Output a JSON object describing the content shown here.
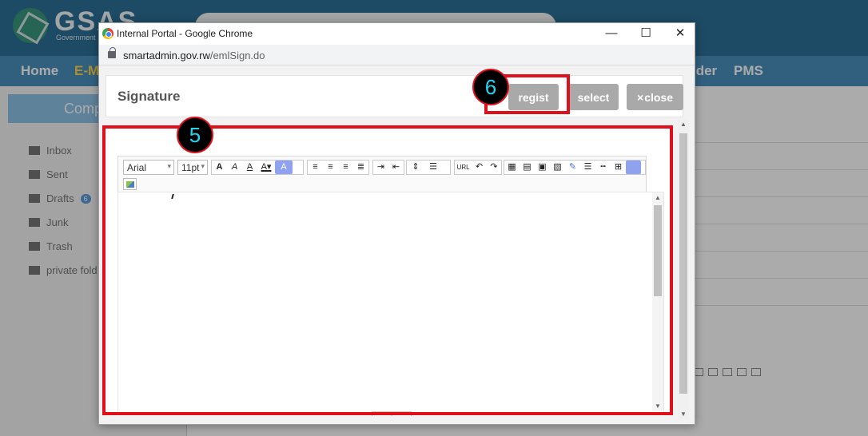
{
  "background": {
    "logo_text": "GSAS",
    "logo_sub": "Government",
    "nav": [
      "Home",
      "E-M",
      "ider",
      "PMS"
    ],
    "compose_label": "Comp",
    "folders": [
      {
        "label": "Inbox",
        "icon": "envelope-icon"
      },
      {
        "label": "Sent",
        "icon": "send-icon"
      },
      {
        "label": "Drafts",
        "icon": "draft-icon",
        "badge": "6"
      },
      {
        "label": "Junk",
        "icon": "warning-icon"
      },
      {
        "label": "Trash",
        "icon": "trash-icon"
      },
      {
        "label": "private fold",
        "icon": "folder-icon"
      }
    ]
  },
  "window": {
    "title": "Internal Portal - Google Chrome",
    "url_host": "smartadmin.gov.rw",
    "url_path": "/emlSign.do",
    "controls": {
      "minimize": "—",
      "maximize": "☐",
      "close": "✕"
    }
  },
  "signature": {
    "title": "Signature",
    "buttons": {
      "regist": "regist",
      "select": "select",
      "close_mark": "×",
      "close": "close"
    }
  },
  "editor": {
    "font_family": "Arial",
    "font_size": "11pt",
    "url_button": "URL"
  },
  "annotations": {
    "marker_5": "5",
    "marker_6": "6",
    "color": "#e0101a"
  }
}
